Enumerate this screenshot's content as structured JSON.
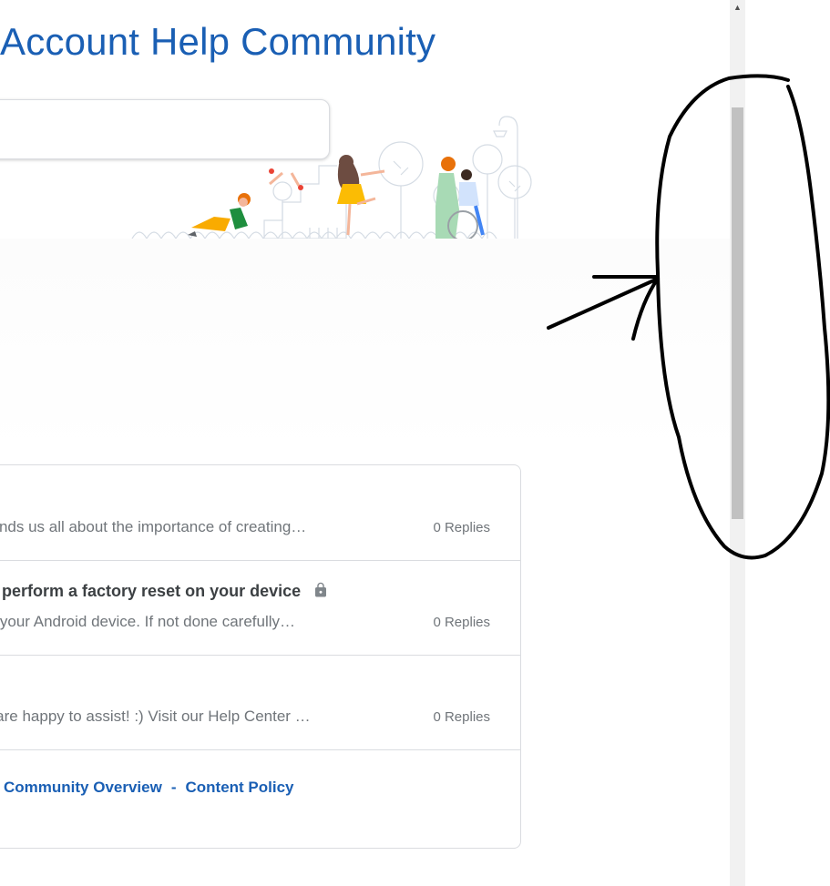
{
  "header": {
    "title": "Account Help Community"
  },
  "threads": [
    {
      "title": "",
      "snippet": "minds us all about the importance of creating…",
      "replies": "0 Replies",
      "locked": false
    },
    {
      "title": ") perform a factory reset on your device",
      "snippet": "et your Android device. If not done carefully…",
      "replies": "0 Replies",
      "locked": true
    },
    {
      "title": "",
      "snippet": "e are happy to assist! :) Visit our Help Center …",
      "replies": "0 Replies",
      "locked": false
    }
  ],
  "footer": {
    "overview_link": "Community Overview",
    "separator": "-",
    "policy_link": "Content Policy"
  },
  "colors": {
    "link": "#1a5fb4",
    "text_muted": "#70757a",
    "text_dark": "#3c4043",
    "border": "#dadce0",
    "scroll_thumb": "#c1c1c1"
  },
  "icons": {
    "lock": "lock-icon",
    "scroll_up": "scroll-up-arrow-icon"
  }
}
